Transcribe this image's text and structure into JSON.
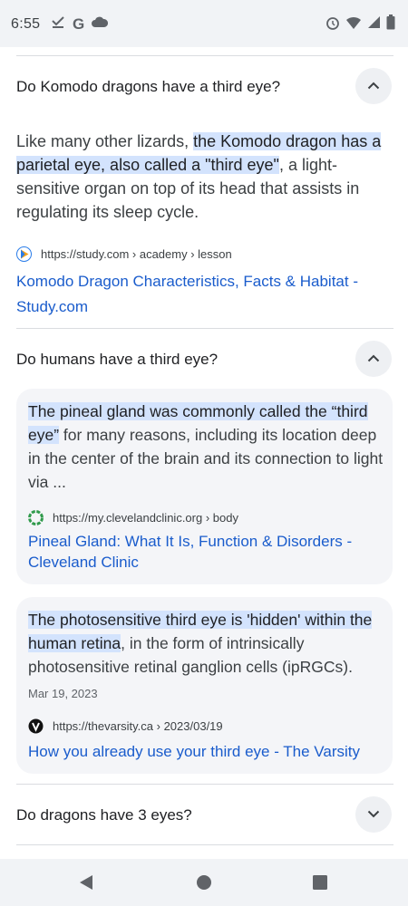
{
  "status_bar": {
    "time": "6:55",
    "left_icons": [
      "download-done-icon",
      "google-g-icon",
      "cloud-icon"
    ],
    "right_icons": [
      "alarm-icon",
      "wifi-icon",
      "cell-signal-icon",
      "battery-icon"
    ]
  },
  "faq": [
    {
      "question": "Do Komodo dragons have a third eye?",
      "expanded": true,
      "answer": {
        "pre": "Like many other lizards, ",
        "highlight": "the Komodo dragon has a parietal eye, also called a \"third eye\"",
        "post": ", a light-sensitive organ on top of its head that assists in regulating its sleep cycle."
      },
      "source_url": "https://study.com › academy › lesson",
      "link_title": "Komodo Dragon Characteristics, Facts & Habitat - Study.com"
    },
    {
      "question": "Do humans have a third eye?",
      "expanded": true,
      "results": [
        {
          "highlight": "The pineal gland was commonly called the “third eye”",
          "post": " for many reasons, including its location deep in the center of the brain and its connection to light via ...",
          "date": "",
          "source_url": "https://my.clevelandclinic.org › body",
          "link_title": "Pineal Gland: What It Is, Function & Disorders - Cleveland Clinic"
        },
        {
          "highlight": "The photosensitive third eye is 'hidden' within the human retina",
          "post": ", in the form of intrinsically photosensitive retinal ganglion cells (ipRGCs).",
          "date": "Mar 19, 2023",
          "source_url": "https://thevarsity.ca › 2023/03/19",
          "link_title": "How you already use your third eye - The Varsity"
        }
      ]
    },
    {
      "question": "Do dragons have 3 eyes?",
      "expanded": false
    }
  ],
  "nav_bar": {
    "buttons": [
      "back-icon",
      "home-icon",
      "recents-icon"
    ]
  },
  "colors": {
    "link": "#1a5ccc",
    "highlight": "#d3e3fd",
    "card_bg": "#f4f5f8",
    "chrome_bg": "#f1f3f6"
  }
}
